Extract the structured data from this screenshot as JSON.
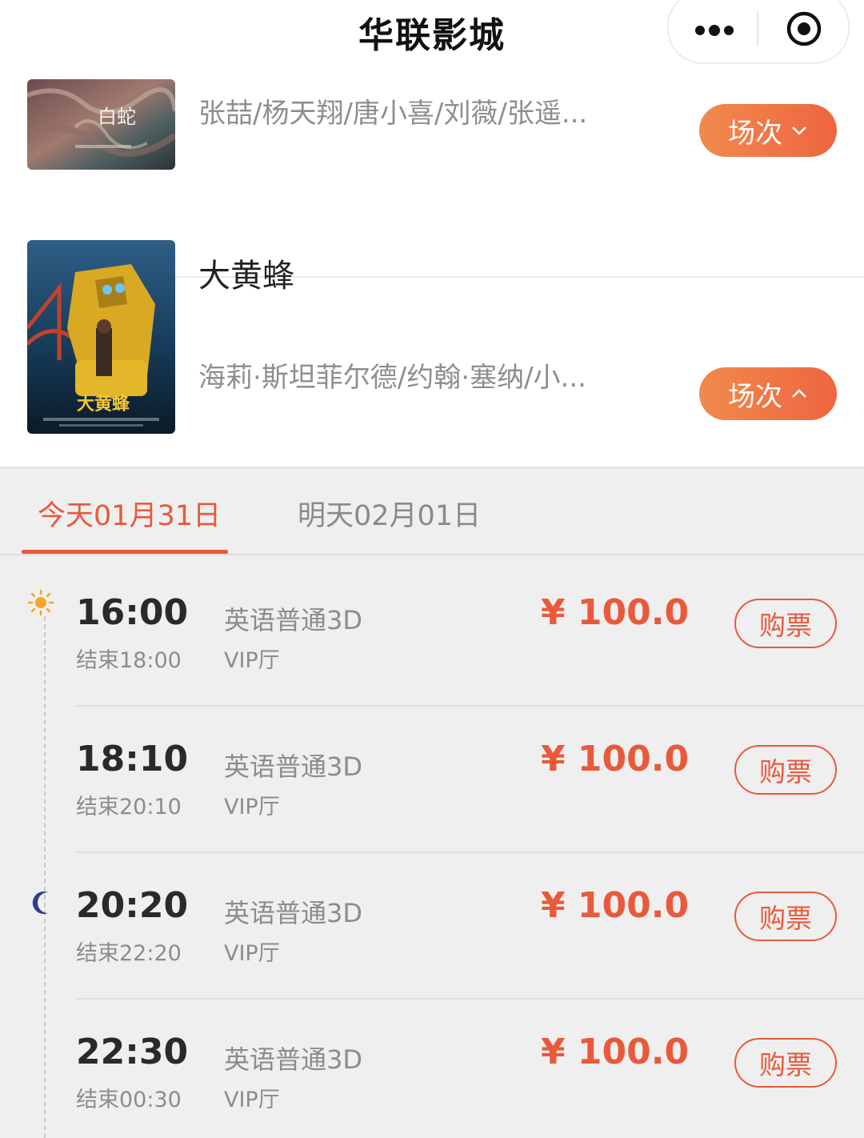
{
  "header": {
    "title": "华联影城",
    "more_icon": "more-dots-icon",
    "close_icon": "target-circle-icon"
  },
  "movies": [
    {
      "title": "",
      "cast": "张喆/杨天翔/唐小喜/刘薇/张遥...",
      "button_label": "场次",
      "expanded": false,
      "poster": "white-snake-poster"
    },
    {
      "title": "大黄蜂",
      "cast": "海莉·斯坦菲尔德/约翰·塞纳/小...",
      "button_label": "场次",
      "expanded": true,
      "poster": "bumblebee-poster"
    }
  ],
  "date_tabs": [
    {
      "label": "今天01月31日",
      "active": true
    },
    {
      "label": "明天02月01日",
      "active": false
    }
  ],
  "sessions": [
    {
      "start": "16:00",
      "end": "结束18:00",
      "language": "英语普通3D",
      "hall": "VIP厅",
      "price": "¥ 100.0",
      "buy_label": "购票"
    },
    {
      "start": "18:10",
      "end": "结束20:10",
      "language": "英语普通3D",
      "hall": "VIP厅",
      "price": "¥ 100.0",
      "buy_label": "购票"
    },
    {
      "start": "20:20",
      "end": "结束22:20",
      "language": "英语普通3D",
      "hall": "VIP厅",
      "price": "¥ 100.0",
      "buy_label": "购票"
    },
    {
      "start": "22:30",
      "end": "结束00:30",
      "language": "英语普通3D",
      "hall": "VIP厅",
      "price": "¥ 100.0",
      "buy_label": "购票"
    }
  ],
  "colors": {
    "accent": "#e9593b",
    "button_gradient_start": "#f08a4d",
    "button_gradient_end": "#ef6540",
    "background": "#efefef"
  }
}
